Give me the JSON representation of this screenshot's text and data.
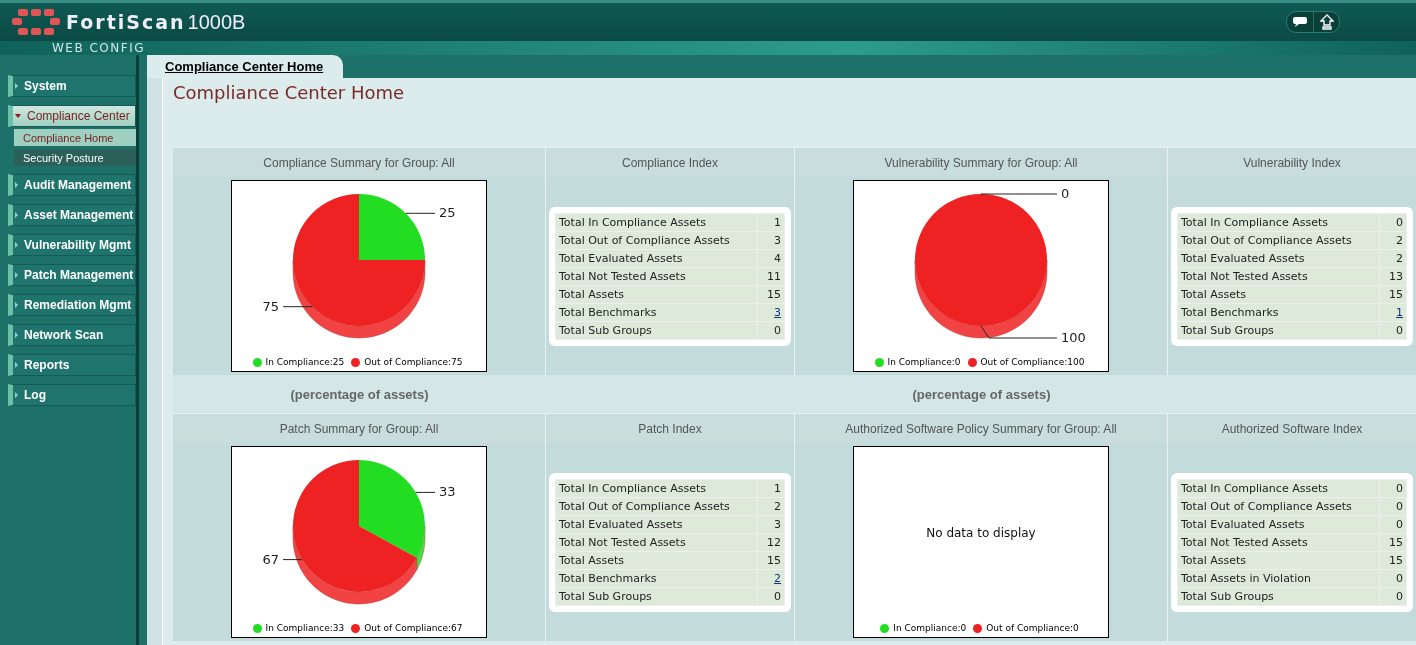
{
  "header": {
    "product": "FortiScan",
    "model": "1000B",
    "subtitle": "WEB CONFIG"
  },
  "sidebar": {
    "items": [
      {
        "label": "System",
        "expanded": false,
        "selected": false
      },
      {
        "label": "Compliance Center",
        "expanded": true,
        "selected": true,
        "children": [
          {
            "label": "Compliance Home",
            "selected": true
          },
          {
            "label": "Security Posture",
            "selected": false
          }
        ]
      },
      {
        "label": "Audit Management",
        "expanded": false,
        "selected": false
      },
      {
        "label": "Asset Management",
        "expanded": false,
        "selected": false
      },
      {
        "label": "Vulnerability Mgmt",
        "expanded": false,
        "selected": false
      },
      {
        "label": "Patch Management",
        "expanded": false,
        "selected": false
      },
      {
        "label": "Remediation Mgmt",
        "expanded": false,
        "selected": false
      },
      {
        "label": "Network Scan",
        "expanded": false,
        "selected": false
      },
      {
        "label": "Reports",
        "expanded": false,
        "selected": false
      },
      {
        "label": "Log",
        "expanded": false,
        "selected": false
      }
    ]
  },
  "tabs": [
    {
      "label": "Compliance Center Home",
      "selected": true
    }
  ],
  "page_title": "Compliance Center Home",
  "rows": [
    {
      "panels": [
        {
          "kind": "chart",
          "title": "Compliance Summary for Group: All",
          "caption": "(percentage of assets)",
          "chart_data": {
            "type": "pie",
            "values": [
              25,
              75
            ],
            "value_labels": [
              "25",
              "75"
            ]
          },
          "legend": [
            {
              "label": "In Compliance:25",
              "color": "#22dd22"
            },
            {
              "label": "Out of Compliance:75",
              "color": "#ee2222"
            }
          ]
        },
        {
          "kind": "index",
          "title": "Compliance Index",
          "rows": [
            {
              "label": "Total In Compliance Assets",
              "value": "1",
              "link": false
            },
            {
              "label": "Total Out of Compliance Assets",
              "value": "3",
              "link": false
            },
            {
              "label": "Total Evaluated Assets",
              "value": "4",
              "link": false
            },
            {
              "label": "Total Not Tested Assets",
              "value": "11",
              "link": false
            },
            {
              "label": "Total Assets",
              "value": "15",
              "link": false
            },
            {
              "label": "Total Benchmarks",
              "value": "3",
              "link": true
            },
            {
              "label": "Total Sub Groups",
              "value": "0",
              "link": false
            }
          ]
        },
        {
          "kind": "chart",
          "title": "Vulnerability Summary for Group: All",
          "caption": "(percentage of assets)",
          "chart_data": {
            "type": "pie",
            "values": [
              0,
              100
            ],
            "value_labels": [
              "0",
              "100"
            ]
          },
          "legend": [
            {
              "label": "In Compliance:0",
              "color": "#22dd22"
            },
            {
              "label": "Out of Compliance:100",
              "color": "#ee2222"
            }
          ]
        },
        {
          "kind": "index",
          "title": "Vulnerability Index",
          "rows": [
            {
              "label": "Total In Compliance Assets",
              "value": "0",
              "link": false
            },
            {
              "label": "Total Out of Compliance Assets",
              "value": "2",
              "link": false
            },
            {
              "label": "Total Evaluated Assets",
              "value": "2",
              "link": false
            },
            {
              "label": "Total Not Tested Assets",
              "value": "13",
              "link": false
            },
            {
              "label": "Total Assets",
              "value": "15",
              "link": false
            },
            {
              "label": "Total Benchmarks",
              "value": "1",
              "link": true
            },
            {
              "label": "Total Sub Groups",
              "value": "0",
              "link": false
            }
          ]
        }
      ]
    },
    {
      "panels": [
        {
          "kind": "chart",
          "title": "Patch Summary for Group: All",
          "chart_data": {
            "type": "pie",
            "values": [
              33,
              67
            ],
            "value_labels": [
              "33",
              "67"
            ]
          },
          "legend": [
            {
              "label": "In Compliance:33",
              "color": "#22dd22"
            },
            {
              "label": "Out of Compliance:67",
              "color": "#ee2222"
            }
          ]
        },
        {
          "kind": "index",
          "title": "Patch Index",
          "rows": [
            {
              "label": "Total In Compliance Assets",
              "value": "1",
              "link": false
            },
            {
              "label": "Total Out of Compliance Assets",
              "value": "2",
              "link": false
            },
            {
              "label": "Total Evaluated Assets",
              "value": "3",
              "link": false
            },
            {
              "label": "Total Not Tested Assets",
              "value": "12",
              "link": false
            },
            {
              "label": "Total Assets",
              "value": "15",
              "link": false
            },
            {
              "label": "Total Benchmarks",
              "value": "2",
              "link": true
            },
            {
              "label": "Total Sub Groups",
              "value": "0",
              "link": false
            }
          ]
        },
        {
          "kind": "chart",
          "title": "Authorized Software Policy Summary for Group: All",
          "message": "No data to display",
          "legend": [
            {
              "label": "In Compliance:0",
              "color": "#22dd22"
            },
            {
              "label": "Out of Compliance:0",
              "color": "#ee2222"
            }
          ]
        },
        {
          "kind": "index",
          "title": "Authorized Software Index",
          "rows": [
            {
              "label": "Total In Compliance Assets",
              "value": "0",
              "link": false
            },
            {
              "label": "Total Out of Compliance Assets",
              "value": "0",
              "link": false
            },
            {
              "label": "Total Evaluated Assets",
              "value": "0",
              "link": false
            },
            {
              "label": "Total Not Tested Assets",
              "value": "15",
              "link": false
            },
            {
              "label": "Total Assets",
              "value": "15",
              "link": false
            },
            {
              "label": "Total Assets in Violation",
              "value": "0",
              "link": false
            },
            {
              "label": "Total Sub Groups",
              "value": "0",
              "link": false
            }
          ]
        }
      ]
    }
  ]
}
